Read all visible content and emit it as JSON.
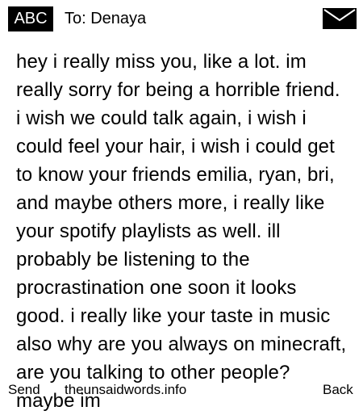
{
  "header": {
    "input_mode": "ABC",
    "recipient_label": "To: Denaya",
    "icon": "envelope-icon"
  },
  "message": {
    "body": "hey i really miss you, like a lot. im really sorry for being a horrible friend. i wish we could talk again, i wish i could feel your hair, i wish i could get to know your friends emilia, ryan, bri, and maybe others more, i really like your spotify playlists as well. ill probably be listening to the procrastination one soon it looks good. i really like your taste in music also why are you always on minecraft, are you talking to other people? maybe im"
  },
  "footer": {
    "send_label": "Send",
    "site_label": "theunsaidwords.info",
    "back_label": "Back"
  }
}
